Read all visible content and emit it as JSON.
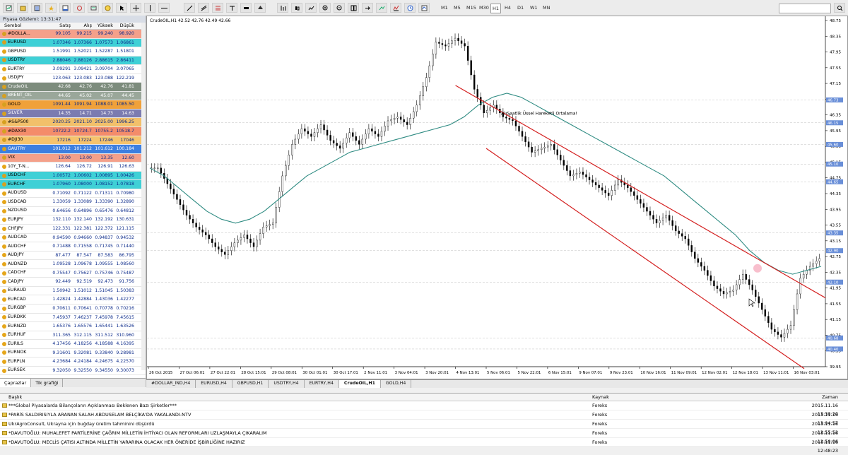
{
  "toolbar": {
    "timeframes": [
      "M1",
      "M5",
      "M15",
      "M30",
      "H1",
      "H4",
      "D1",
      "W1",
      "MN"
    ],
    "active_timeframe": "H1"
  },
  "market_watch": {
    "title": "Piyasa Gözlemi: 13:31:47",
    "headers": {
      "symbol": "Sembol",
      "bid": "Satış",
      "ask": "Alış",
      "high": "Yüksek",
      "low": "Düşük"
    },
    "rows": [
      {
        "s": "#DOLLA...",
        "b": "99.105",
        "a": "99.215",
        "h": "99.240",
        "l": "98.920",
        "bg": "#f4a08a"
      },
      {
        "s": "EURUSD",
        "b": "1.07346",
        "a": "1.07366",
        "h": "1.07573",
        "l": "1.06861",
        "bg": "#3fd0d6"
      },
      {
        "s": "GBPUSD",
        "b": "1.51991",
        "a": "1.52021",
        "h": "1.52287",
        "l": "1.51801",
        "bg": "#ffffff"
      },
      {
        "s": "USDTRY",
        "b": "2.88046",
        "a": "2.88126",
        "h": "2.88615",
        "l": "2.86411",
        "bg": "#3fd0d6"
      },
      {
        "s": "EURTRY",
        "b": "3.09291",
        "a": "3.09421",
        "h": "3.09704",
        "l": "3.07065",
        "bg": "#ffffff"
      },
      {
        "s": "USDJPY",
        "b": "123.063",
        "a": "123.083",
        "h": "123.088",
        "l": "122.219",
        "bg": "#ffffff"
      },
      {
        "s": "CrudeOIL",
        "b": "42.68",
        "a": "42.76",
        "h": "42.76",
        "l": "41.81",
        "bg": "#7d8c7d"
      },
      {
        "s": "BRENT_OIL",
        "b": "44.65",
        "a": "45.02",
        "h": "45.07",
        "l": "44.45",
        "bg": "#9aa79a"
      },
      {
        "s": "GOLD",
        "b": "1091.44",
        "a": "1091.94",
        "h": "1088.01",
        "l": "1085.50",
        "bg": "#f0a13a"
      },
      {
        "s": "SILVER",
        "b": "14.35",
        "a": "14.71",
        "h": "14.73",
        "l": "14.63",
        "bg": "#7b7bb0"
      },
      {
        "s": "#S&P500",
        "b": "2020.25",
        "a": "2021.10",
        "h": "2025.00",
        "l": "1996.25",
        "bg": "#f2c06a"
      },
      {
        "s": "#DAX30",
        "b": "10722.2",
        "a": "10724.7",
        "h": "10755.2",
        "l": "10518.7",
        "bg": "#f48c6a"
      },
      {
        "s": "#DJI30",
        "b": "17216",
        "a": "17224",
        "h": "17246",
        "l": "17046",
        "bg": "#f6c36c"
      },
      {
        "s": "GAUTRY",
        "b": "101.012",
        "a": "101.212",
        "h": "101.612",
        "l": "100.184",
        "bg": "#3d7fe0"
      },
      {
        "s": "VIX",
        "b": "13.00",
        "a": "13.00",
        "h": "13.35",
        "l": "12.60",
        "bg": "#f4a08a"
      },
      {
        "s": "10Y_T-N...",
        "b": "126.64",
        "a": "126.72",
        "h": "126.91",
        "l": "126.63",
        "bg": "#ffffff"
      },
      {
        "s": "USDCHF",
        "b": "1.00572",
        "a": "1.00602",
        "h": "1.00895",
        "l": "1.00426",
        "bg": "#3fd0d6"
      },
      {
        "s": "EURCHF",
        "b": "1.07960",
        "a": "1.08000",
        "h": "1.08152",
        "l": "1.07818",
        "bg": "#3fd0d6"
      },
      {
        "s": "AUDUSD",
        "b": "0.71092",
        "a": "0.71122",
        "h": "0.71311",
        "l": "0.70980",
        "bg": "#ffffff"
      },
      {
        "s": "USDCAD",
        "b": "1.33059",
        "a": "1.33089",
        "h": "1.33390",
        "l": "1.32890",
        "bg": "#ffffff"
      },
      {
        "s": "NZDUSD",
        "b": "0.64656",
        "a": "0.64896",
        "h": "0.65476",
        "l": "0.64812",
        "bg": "#ffffff"
      },
      {
        "s": "EURJPY",
        "b": "132.110",
        "a": "132.140",
        "h": "132.192",
        "l": "130.631",
        "bg": "#ffffff"
      },
      {
        "s": "CHFJPY",
        "b": "122.331",
        "a": "122.381",
        "h": "122.372",
        "l": "121.115",
        "bg": "#ffffff"
      },
      {
        "s": "AUDCAD",
        "b": "0.94590",
        "a": "0.94660",
        "h": "0.94837",
        "l": "0.94532",
        "bg": "#ffffff"
      },
      {
        "s": "AUDCHF",
        "b": "0.71488",
        "a": "0.71558",
        "h": "0.71745",
        "l": "0.71440",
        "bg": "#ffffff"
      },
      {
        "s": "AUDJPY",
        "b": "87.477",
        "a": "87.547",
        "h": "87.583",
        "l": "86.795",
        "bg": "#ffffff"
      },
      {
        "s": "AUDNZD",
        "b": "1.09528",
        "a": "1.09678",
        "h": "1.09555",
        "l": "1.08560",
        "bg": "#ffffff"
      },
      {
        "s": "CADCHF",
        "b": "0.75547",
        "a": "0.75627",
        "h": "0.75746",
        "l": "0.75487",
        "bg": "#ffffff"
      },
      {
        "s": "CADJPY",
        "b": "92.449",
        "a": "92.519",
        "h": "92.473",
        "l": "91.756",
        "bg": "#ffffff"
      },
      {
        "s": "EURAUD",
        "b": "1.50942",
        "a": "1.51012",
        "h": "1.51045",
        "l": "1.50383",
        "bg": "#ffffff"
      },
      {
        "s": "EURCAD",
        "b": "1.42824",
        "a": "1.42884",
        "h": "1.43036",
        "l": "1.42277",
        "bg": "#ffffff"
      },
      {
        "s": "EURGBP",
        "b": "0.70611",
        "a": "0.70641",
        "h": "0.70778",
        "l": "0.70216",
        "bg": "#ffffff"
      },
      {
        "s": "EURDKK",
        "b": "7.45937",
        "a": "7.46237",
        "h": "7.45978",
        "l": "7.45615",
        "bg": "#ffffff"
      },
      {
        "s": "EURNZD",
        "b": "1.65376",
        "a": "1.65576",
        "h": "1.65441",
        "l": "1.63526",
        "bg": "#ffffff"
      },
      {
        "s": "EURHUF",
        "b": "311.365",
        "a": "312.115",
        "h": "311.512",
        "l": "310.960",
        "bg": "#ffffff"
      },
      {
        "s": "EURILS",
        "b": "4.17456",
        "a": "4.18256",
        "h": "4.18588",
        "l": "4.16395",
        "bg": "#ffffff"
      },
      {
        "s": "EURNOK",
        "b": "9.31601",
        "a": "9.32081",
        "h": "9.33840",
        "l": "9.28981",
        "bg": "#ffffff"
      },
      {
        "s": "EURPLN",
        "b": "4.23684",
        "a": "4.24184",
        "h": "4.24675",
        "l": "4.22570",
        "bg": "#ffffff"
      },
      {
        "s": "EURSEK",
        "b": "9.32050",
        "a": "9.32550",
        "h": "9.34550",
        "l": "9.30073",
        "bg": "#ffffff"
      }
    ],
    "tabs": [
      "Çaprazlar",
      "Tik grafiği"
    ]
  },
  "chart": {
    "symbol_label": "CrudeOIL,H1  42.52 42.76 42.49 42.66",
    "annotation": "70 Saatlik Üssel Hareketli Ortalama!",
    "price_ticks": [
      "48.75",
      "48.35",
      "47.95",
      "47.55",
      "47.15",
      "46.75",
      "46.35",
      "45.95",
      "45.55",
      "45.15",
      "44.75",
      "44.35",
      "43.95",
      "43.55",
      "43.15",
      "42.75",
      "42.35",
      "41.95",
      "41.55",
      "41.15",
      "40.75",
      "40.35",
      "39.95"
    ],
    "highlight_prices": [
      "46.73",
      "46.15",
      "45.60",
      "45.10",
      "44.65",
      "43.35",
      "42.90",
      "42.10",
      "40.68",
      "40.40"
    ],
    "time_ticks": [
      "26 Oct 2015",
      "27 Oct 06:01",
      "27 Oct 22:01",
      "28 Oct 15:01",
      "29 Oct 08:01",
      "30 Oct 01:01",
      "30 Oct 17:01",
      "2 Nov 11:01",
      "3 Nov 04:01",
      "3 Nov 20:01",
      "4 Nov 13:01",
      "5 Nov 06:01",
      "5 Nov 22:01",
      "6 Nov 15:01",
      "9 Nov 07:01",
      "9 Nov 23:01",
      "10 Nov 16:01",
      "11 Nov 09:01",
      "12 Nov 02:01",
      "12 Nov 18:01",
      "13 Nov 11:01",
      "16 Nov 03:01"
    ],
    "tabs": [
      "#DOLLAR_IND,H4",
      "EURUSD,H4",
      "GBPUSD,H1",
      "USDTRY,H4",
      "EURTRY,H4",
      "CrudeOIL,H1",
      "GOLD,H4"
    ],
    "active_tab": "CrudeOIL,H1",
    "colors": {
      "candles": "#000000",
      "ema": "#2e8b82",
      "channel": "#d42020",
      "grid": "#c0c0c0"
    }
  },
  "chart_data": {
    "type": "line",
    "title": "CrudeOIL,H1",
    "ylim": [
      39.95,
      48.75
    ],
    "series": [
      {
        "values": [
          45.0,
          44.6,
          44.2,
          43.8,
          43.5,
          43.3,
          43.0,
          42.8,
          43.1,
          43.3,
          43.0,
          43.5,
          43.6,
          44.8,
          45.6,
          46.0,
          45.8,
          46.1,
          45.7,
          45.5,
          45.9,
          45.6,
          46.0,
          45.8,
          46.2,
          46.3,
          46.1,
          46.6,
          47.3,
          48.2,
          48.1,
          48.3,
          48.1,
          47.0,
          46.4,
          46.6,
          46.3,
          46.2,
          45.8,
          45.4,
          45.5,
          45.6,
          45.2,
          44.8,
          44.9,
          44.7,
          44.5,
          44.3,
          44.7,
          44.5,
          44.2,
          43.9,
          43.6,
          43.8,
          43.4,
          43.2,
          42.7,
          42.4,
          42.0,
          41.8,
          41.9,
          42.3,
          41.9,
          41.4,
          40.9,
          40.7,
          41.0,
          42.2,
          42.5,
          42.7
        ]
      },
      {
        "name": "70 Saatlik Üssel Hareketli Ortalama!",
        "values": [
          45.0,
          44.8,
          44.5,
          44.2,
          43.9,
          43.7,
          43.6,
          43.7,
          43.9,
          44.2,
          44.5,
          44.8,
          45.0,
          45.2,
          45.4,
          45.5,
          45.6,
          45.7,
          45.8,
          45.9,
          46.0,
          46.1,
          46.3,
          46.6,
          46.8,
          46.9,
          46.8,
          46.6,
          46.4,
          46.2,
          46.0,
          45.8,
          45.6,
          45.4,
          45.2,
          45.0,
          44.8,
          44.5,
          44.2,
          43.9,
          43.6,
          43.3,
          42.9,
          42.6,
          42.4,
          42.3,
          42.4,
          42.5
        ]
      }
    ],
    "channel": {
      "upper": [
        [
          47.1,
          "4 Nov 13:01"
        ],
        [
          41.7,
          "16 Nov 03:01"
        ]
      ],
      "lower": [
        [
          45.5,
          "5 Nov 06:01"
        ],
        [
          39.9,
          "16 Nov 03:01"
        ]
      ]
    }
  },
  "terminal": {
    "headers": {
      "title": "Başlık",
      "source": "Kaynak",
      "time": "Zaman"
    },
    "rows": [
      {
        "t": "***Global Piyasalarda Bilançoların Açıklanması Beklenen Bazı Şirketler***",
        "s": "Foreks",
        "z": "2015.11.16 13:30:20"
      },
      {
        "t": "*PARİS SALDIRISIYLA ARANAN SALAH ABDUSELAM BELÇİKA'DA YAKALANDI-NTV",
        "s": "Foreks",
        "z": "2015.11.16 13:04:57"
      },
      {
        "t": "UkrAgroConsult, Ukrayna için buğday üretim tahminini düşürdü",
        "s": "Foreks",
        "z": "2015.11.16 12:55:52"
      },
      {
        "t": "*DAVUTOĞLU: MUHALEFET PARTİLERİNE ÇAĞRIM MİLLETİN İHTİYACI OLAN REFORMLARI UZLAŞMAYLA ÇIKARALIM",
        "s": "Foreks",
        "z": "2015.11.16 12:50:06"
      },
      {
        "t": "*DAVUTOĞLU: MECLİS ÇATISI ALTINDA MİLLETİN YARARINA OLACAK HER ÖNERİDE İŞBİRLİĞİNE HAZIRIZ",
        "s": "Foreks",
        "z": "2015.11.16 12:48:23"
      }
    ]
  }
}
